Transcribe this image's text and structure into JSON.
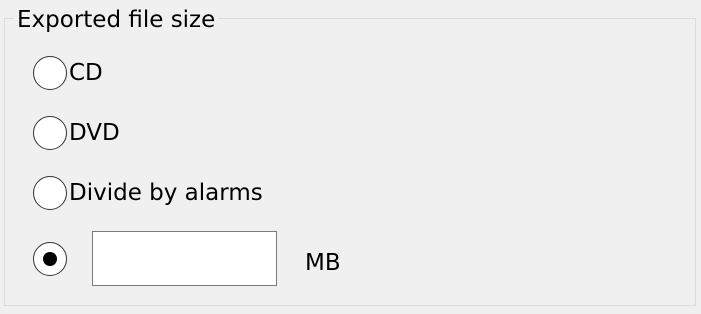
{
  "group": {
    "title": "Exported file size"
  },
  "options": [
    {
      "label": "CD",
      "checked": false
    },
    {
      "label": "DVD",
      "checked": false
    },
    {
      "label": "Divide by alarms",
      "checked": false
    },
    {
      "label": "",
      "checked": true
    }
  ],
  "custom_size": {
    "value": "",
    "unit": "MB"
  }
}
